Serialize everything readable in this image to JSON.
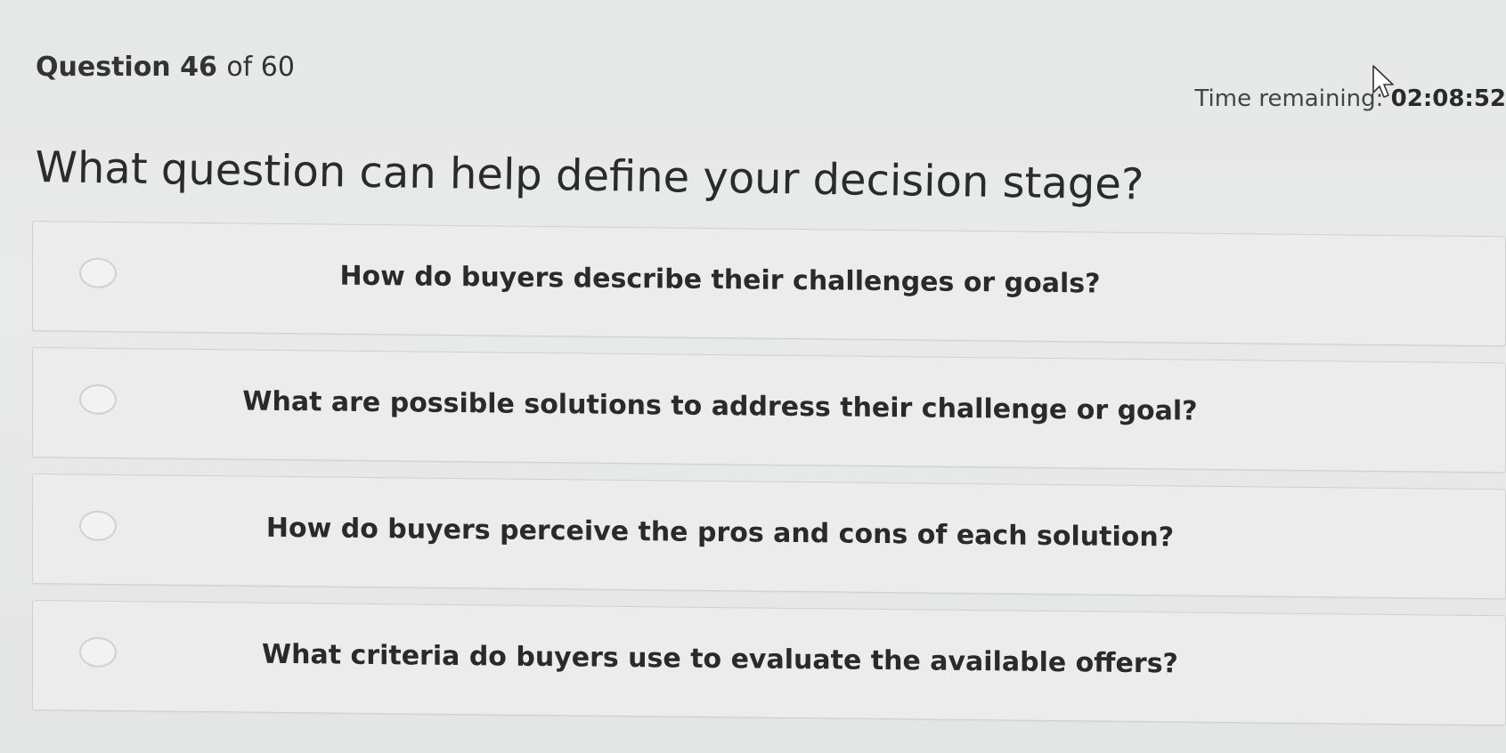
{
  "header": {
    "question_label": "Question 46",
    "question_of": "of 60",
    "time_label": "Time remaining:",
    "time_value": "02:08:52"
  },
  "question": {
    "text": "What question can help define your decision stage?"
  },
  "options": [
    {
      "label": "How do buyers describe their challenges or goals?"
    },
    {
      "label": "What are possible solutions to address their challenge or goal?"
    },
    {
      "label": "How do buyers perceive the pros and cons of each solution?"
    },
    {
      "label": "What criteria do buyers use to evaluate the available offers?"
    }
  ],
  "icons": {
    "cursor": "mouse-pointer-icon",
    "radio": "radio-unselected-icon"
  },
  "colors": {
    "background": "#e9eaea",
    "card": "#ececec",
    "text": "#2b2b2b"
  }
}
